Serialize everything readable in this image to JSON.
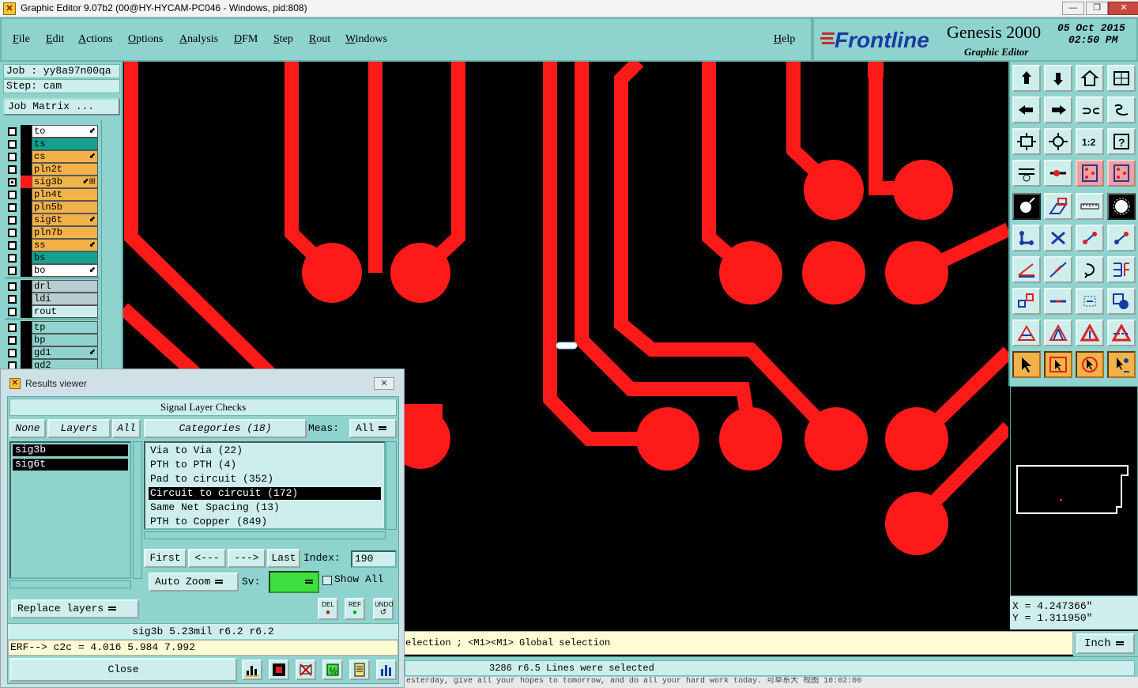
{
  "window": {
    "title": "Graphic Editor 9.07b2 (00@HY-HYCAM-PC046 - Windows, pid:808)",
    "minimize": "—",
    "maximize": "❐",
    "close": "✕"
  },
  "menu": {
    "items": [
      "File",
      "Edit",
      "Actions",
      "Options",
      "Analysis",
      "DFM",
      "Step",
      "Rout",
      "Windows"
    ],
    "help": "Help"
  },
  "brand": {
    "logo": "Frontline",
    "product": "Genesis 2000",
    "subtitle": "Graphic Editor",
    "date": "05 Oct 2015",
    "time": "02:50 PM"
  },
  "job": {
    "job_line": "Job : yy8a97n00qa",
    "step_line": "Step: cam",
    "matrix_button": "Job Matrix ..."
  },
  "layers": [
    {
      "name": "to",
      "color": "#ffffff",
      "marker": "⬋"
    },
    {
      "name": "ts",
      "color": "#11a38f",
      "marker": ""
    },
    {
      "name": "cs",
      "color": "#f2b24a",
      "marker": "⬋"
    },
    {
      "name": "pln2t",
      "color": "#f2b24a",
      "marker": ""
    },
    {
      "name": "sig3b",
      "color": "#f2b24a",
      "marker": "⬋⊞",
      "active": true
    },
    {
      "name": "pln4t",
      "color": "#f2b24a",
      "marker": ""
    },
    {
      "name": "pln5b",
      "color": "#f2b24a",
      "marker": ""
    },
    {
      "name": "sig6t",
      "color": "#f2b24a",
      "marker": "⬋"
    },
    {
      "name": "pln7b",
      "color": "#f2b24a",
      "marker": ""
    },
    {
      "name": "ss",
      "color": "#f2b24a",
      "marker": "⬋"
    },
    {
      "name": "bs",
      "color": "#11a38f",
      "marker": ""
    },
    {
      "name": "bo",
      "color": "#ffffff",
      "marker": "⬋"
    },
    {
      "name": "drl",
      "color": "#b8cdd0",
      "marker": ""
    },
    {
      "name": "ldi",
      "color": "#b8cdd0",
      "marker": ""
    },
    {
      "name": "rout",
      "color": "#cdeeec",
      "marker": ""
    },
    {
      "name": "tp",
      "color": "#8fd3ce",
      "marker": ""
    },
    {
      "name": "bp",
      "color": "#8fd3ce",
      "marker": ""
    },
    {
      "name": "gd1",
      "color": "#8fd3ce",
      "marker": "⬋"
    },
    {
      "name": "gd2",
      "color": "#8fd3ce",
      "marker": ""
    }
  ],
  "coordinates": {
    "x": "X  = 4.247366\"",
    "y": "Y  = 1.311950\""
  },
  "status": {
    "prompt": "election ; <M1><M1> Global selection",
    "unit": "Inch",
    "message": "3286 r6.5 Lines were selected",
    "taskbar": "esterday, give all your hopes to tomorrow, and do all your hard work today.          可卓系大          视图          10:02:00"
  },
  "results_viewer": {
    "title": "Results viewer",
    "close_x": "✕",
    "header": "Signal Layer Checks",
    "none_btn": "None",
    "layers_btn": "Layers",
    "all_btn": "All",
    "categories_btn": "Categories (18)",
    "meas_label": "Meas:",
    "meas_value": "All",
    "layer_items": [
      "sig3b",
      "sig6t"
    ],
    "categories": [
      {
        "label": "Via to Via (22)"
      },
      {
        "label": "PTH to PTH (4)"
      },
      {
        "label": "Pad to circuit (352)"
      },
      {
        "label": "Circuit to circuit (172)",
        "selected": true
      },
      {
        "label": "Same Net Spacing (13)"
      },
      {
        "label": "PTH to Copper (849)"
      }
    ],
    "first": "First",
    "prev": "<---",
    "next": "--->",
    "last": "Last",
    "index_label": "Index:",
    "index_value": "190",
    "zoom_mode": "Auto Zoom",
    "sv_label": "Sv:",
    "sv_color": "#3ee03e",
    "show_all": "Show All",
    "del": "DEL",
    "ref": "REF",
    "undo": "UNDO",
    "replace_layers": "Replace layers",
    "info": "sig3b 5.23mil  r6.2  r6.2",
    "erf": "ERF--> c2c = 4.016 5.984 7.992",
    "close": "Close"
  },
  "colors": {
    "panel": "#8fd3ce",
    "panel_light": "#cdeeec",
    "trace": "#ff1a1a",
    "active_tool": "#f2b24a"
  }
}
